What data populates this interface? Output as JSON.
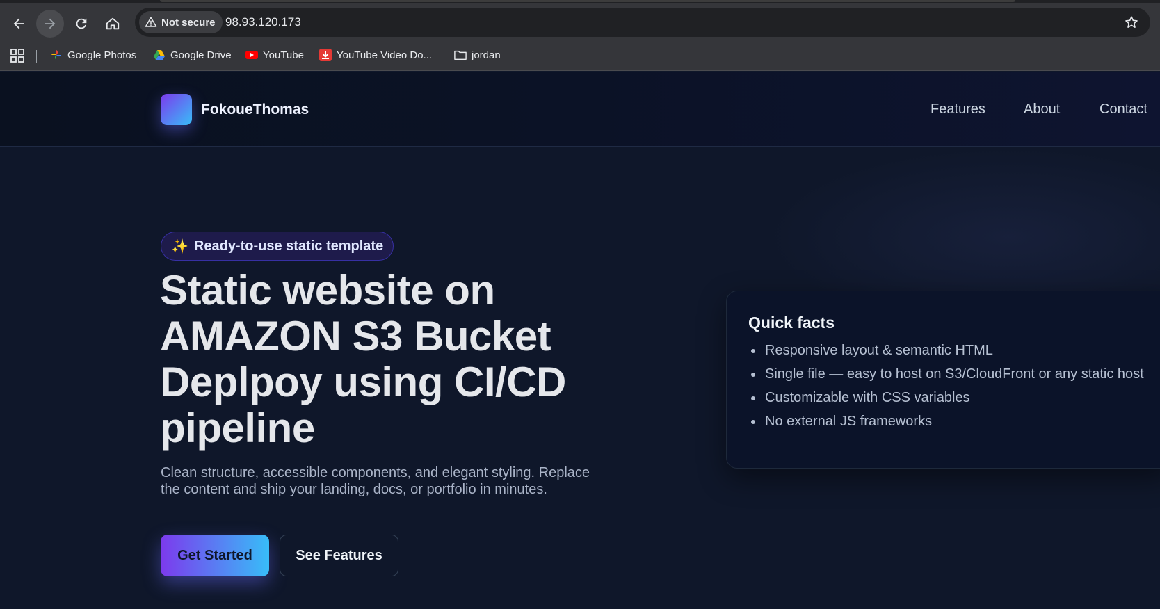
{
  "browser": {
    "url": "98.93.120.173",
    "security_label": "Not secure",
    "bookmarks": [
      {
        "label": "Google Photos",
        "icon": "google-photos-icon"
      },
      {
        "label": "Google Drive",
        "icon": "google-drive-icon"
      },
      {
        "label": "YouTube",
        "icon": "youtube-icon"
      },
      {
        "label": "YouTube Video Do...",
        "icon": "download-icon"
      },
      {
        "label": "jordan",
        "icon": "folder-icon"
      }
    ]
  },
  "site": {
    "brand": "FokoueThomas",
    "nav": [
      {
        "label": "Features"
      },
      {
        "label": "About"
      },
      {
        "label": "Contact"
      }
    ]
  },
  "hero": {
    "badge_emoji": "✨",
    "badge_text": "Ready-to-use static template",
    "title_lines": [
      "Static website on",
      "AMAZON S3 Bucket",
      "Deplpoy using CI/CD",
      "pipeline"
    ],
    "subtitle": "Clean structure, accessible components, and elegant styling. Replace the content and ship your landing, docs, or portfolio in minutes.",
    "primary_cta": "Get Started",
    "secondary_cta": "See Features"
  },
  "quick_facts": {
    "title": "Quick facts",
    "items": [
      "Responsive layout & semantic HTML",
      "Single file — easy to host on S3/CloudFront or any static host",
      "Customizable with CSS variables",
      "No external JS frameworks"
    ]
  },
  "colors": {
    "accent_start": "#7c3aed",
    "accent_end": "#38bdf8",
    "page_bg": "#0f172a"
  }
}
